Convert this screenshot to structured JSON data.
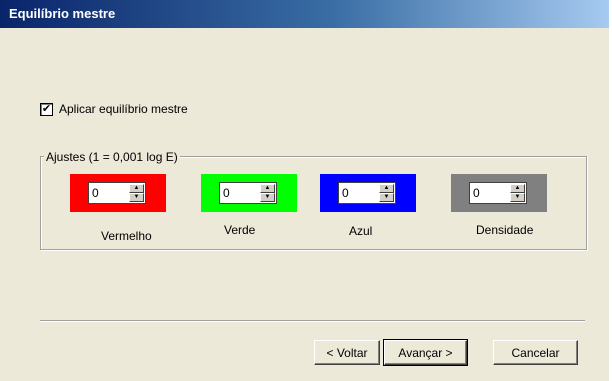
{
  "window": {
    "title": "Equilíbrio mestre"
  },
  "checkbox": {
    "label": "Aplicar equilíbrio mestre",
    "checked": true,
    "mark": "✔"
  },
  "groupbox": {
    "label": "Ajustes (1 = 0,001 log E)"
  },
  "adjustments": [
    {
      "label": "Vermelho",
      "value": "0",
      "color": "#ff0000"
    },
    {
      "label": "Verde",
      "value": "0",
      "color": "#00ff00"
    },
    {
      "label": "Azul",
      "value": "0",
      "color": "#0000ff"
    },
    {
      "label": "Densidade",
      "value": "0",
      "color": "#808080"
    }
  ],
  "spin_icons": {
    "up": "▲",
    "down": "▼"
  },
  "buttons": {
    "back": "< Voltar",
    "next": "Avançar >",
    "cancel": "Cancelar"
  }
}
